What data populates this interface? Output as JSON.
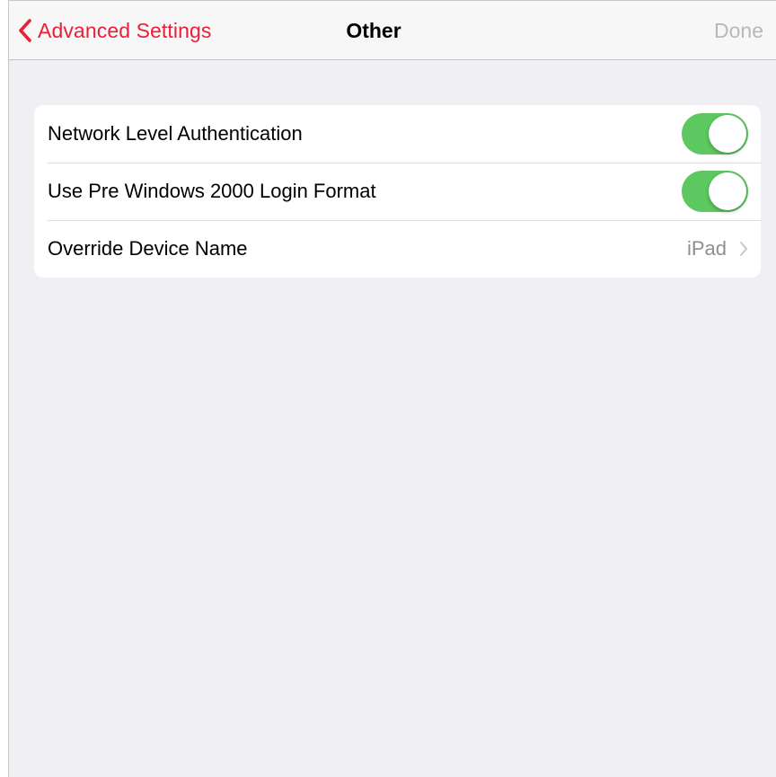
{
  "navbar": {
    "back_label": "Advanced Settings",
    "title": "Other",
    "done_label": "Done"
  },
  "settings": {
    "rows": [
      {
        "label": "Network Level Authentication",
        "type": "toggle",
        "on": true
      },
      {
        "label": "Use Pre Windows 2000 Login Format",
        "type": "toggle",
        "on": true
      },
      {
        "label": "Override Device Name",
        "type": "disclosure",
        "value": "iPad"
      }
    ]
  },
  "colors": {
    "accent": "#e8203a",
    "toggle_on": "#5cc85f",
    "background": "#efeff4",
    "disabled_text": "#b8b8bc",
    "secondary_text": "#8e8e93"
  },
  "icons": {
    "back": "chevron-left-icon",
    "disclosure": "chevron-right-icon"
  }
}
